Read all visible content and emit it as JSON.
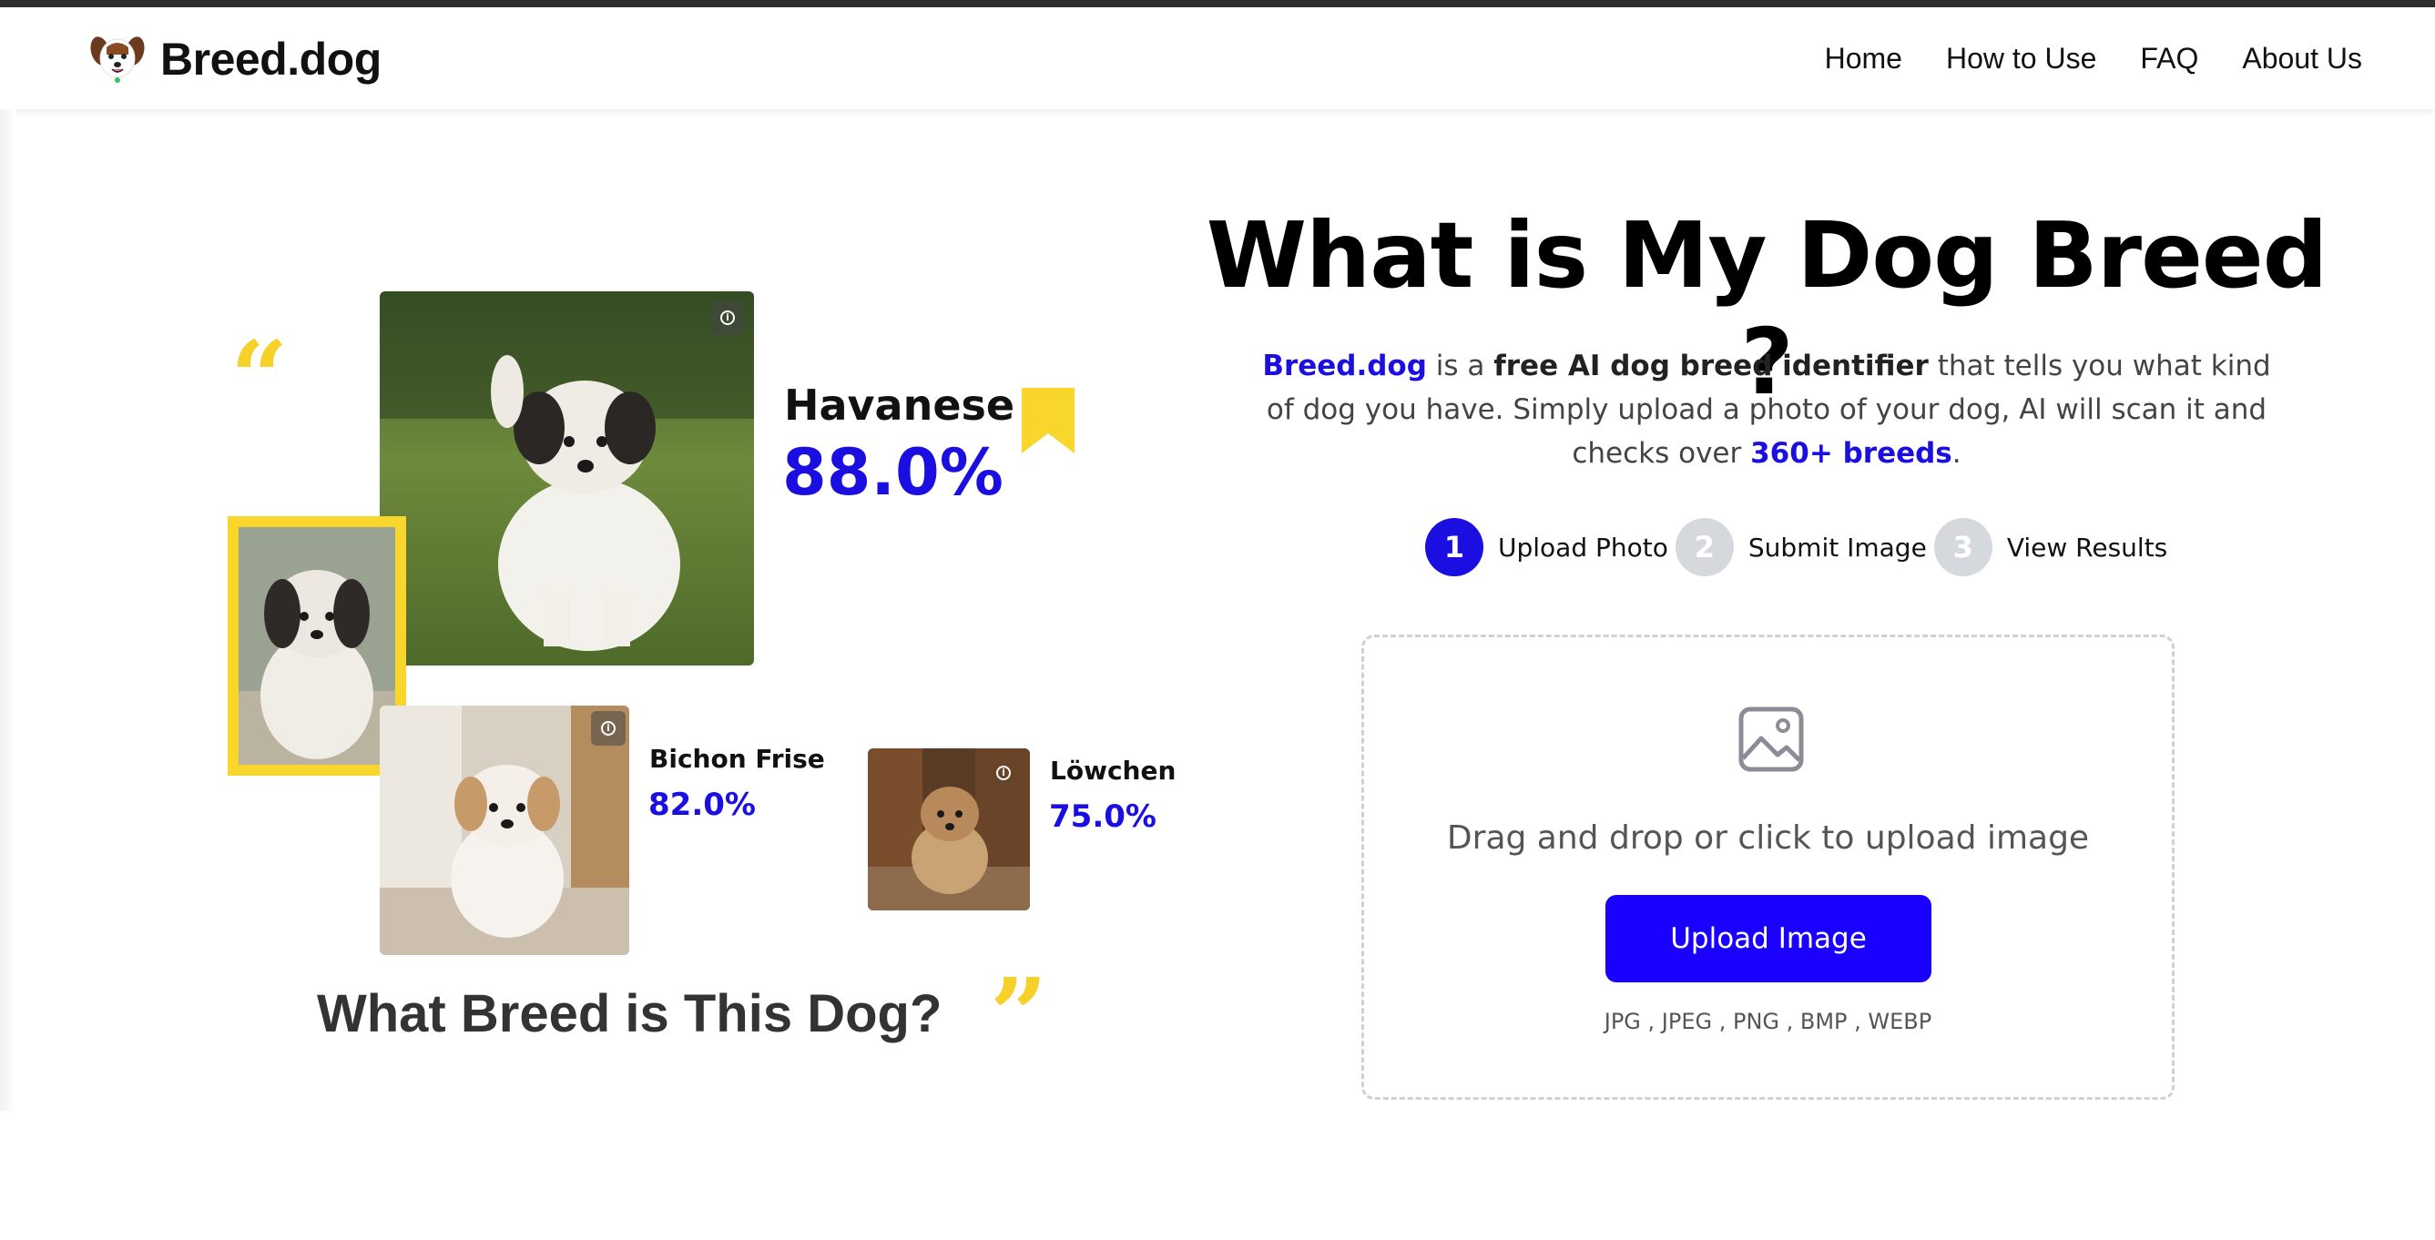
{
  "brand": {
    "name": "Breed.dog"
  },
  "nav": {
    "links": [
      {
        "label": "Home"
      },
      {
        "label": "How to Use"
      },
      {
        "label": "FAQ"
      },
      {
        "label": "About Us"
      }
    ]
  },
  "collage": {
    "quote_open": "“",
    "quote_close": "”",
    "results": [
      {
        "breed": "Havanese",
        "confidence": "88.0%"
      },
      {
        "breed": "Bichon Frise",
        "confidence": "82.0%"
      },
      {
        "breed": "Löwchen",
        "confidence": "75.0%"
      }
    ],
    "caption": "What Breed is This Dog?"
  },
  "hero": {
    "title": "What is My Dog Breed ?",
    "desc": {
      "brand": "Breed.dog",
      "t1": " is a ",
      "strong": "free AI dog breed identifier",
      "t2": " that tells you what kind of dog you have. Simply upload a photo of your dog, AI will scan it and checks over ",
      "count": "360+ breeds",
      "t3": "."
    }
  },
  "steps": [
    {
      "num": "1",
      "label": "Upload Photo",
      "active": true
    },
    {
      "num": "2",
      "label": "Submit Image",
      "active": false
    },
    {
      "num": "3",
      "label": "View Results",
      "active": false
    }
  ],
  "upload": {
    "prompt": "Drag and drop or click to upload image",
    "button": "Upload Image",
    "formats": "JPG , JPEG , PNG , BMP , WEBP"
  },
  "colors": {
    "accent": "#1a00ff",
    "highlight_yellow": "#f9d62b",
    "step_inactive": "#d5d9de"
  }
}
